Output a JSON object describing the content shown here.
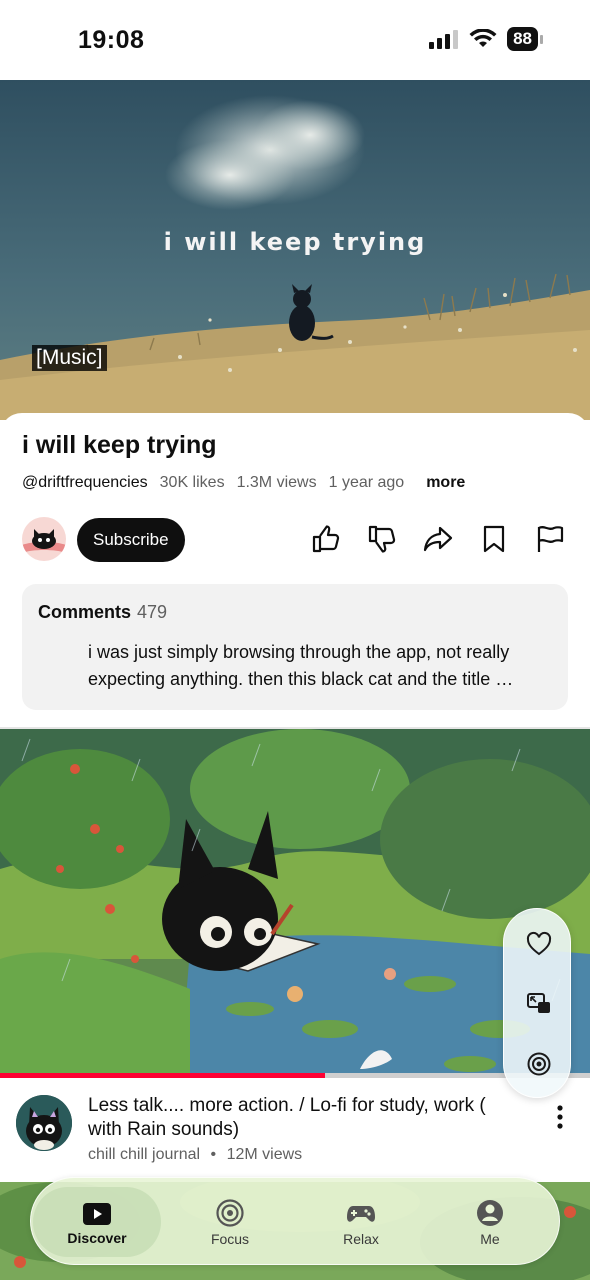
{
  "status_bar": {
    "time": "19:08",
    "battery": "88"
  },
  "hero": {
    "overlay_text": "i will keep trying",
    "caption": "[Music]"
  },
  "video": {
    "title": "i will keep trying",
    "channel": "@driftfrequencies",
    "likes": "30K likes",
    "views": "1.3M views",
    "age": "1 year ago",
    "more_label": "more",
    "subscribe_label": "Subscribe"
  },
  "actions": [
    "like-icon",
    "dislike-icon",
    "share-icon",
    "save-icon",
    "report-icon"
  ],
  "comments": {
    "label": "Comments",
    "count": "479",
    "preview": "i was just simply browsing through the app, not really expecting anything. then this black cat and the title …"
  },
  "next_video": {
    "title": "Less talk.... more action. / Lo-fi for study, work ( with Rain sounds)",
    "channel": "chill chill journal",
    "separator": "•",
    "views": "12M views",
    "progress": 0.55
  },
  "floating_actions": [
    "heart-icon",
    "picture-in-picture-icon",
    "focus-target-icon"
  ],
  "nav": {
    "items": [
      {
        "label": "Discover",
        "icon": "play-icon",
        "active": true
      },
      {
        "label": "Focus",
        "icon": "target-icon",
        "active": false
      },
      {
        "label": "Relax",
        "icon": "gamepad-icon",
        "active": false
      },
      {
        "label": "Me",
        "icon": "profile-icon",
        "active": false
      }
    ]
  },
  "colors": {
    "accent": "#ff0033",
    "subscribe_bg": "#0f0f0f",
    "nav_bg": "#e8f4d6"
  }
}
